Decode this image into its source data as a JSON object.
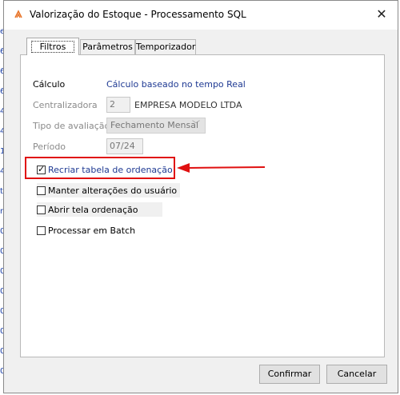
{
  "background": {
    "side_markers": [
      "e",
      "6",
      "6",
      "6",
      "4",
      "4",
      "1",
      "4",
      "t",
      "n",
      "0",
      "0",
      "0",
      "0",
      "0",
      "0",
      "0",
      "0"
    ]
  },
  "window": {
    "title": "Valorização do Estoque - Processamento SQL",
    "close_glyph": "✕"
  },
  "tabs": [
    {
      "label": "Filtros",
      "active": true
    },
    {
      "label": "Parâmetros",
      "active": false
    },
    {
      "label": "Temporizador",
      "active": false
    }
  ],
  "form": {
    "calculo_label": "Cálculo",
    "calculo_value": "Cálculo baseado no tempo Real",
    "centralizadora_label": "Centralizadora",
    "centralizadora_code": "2",
    "centralizadora_name": "EMPRESA MODELO LTDA",
    "tipo_label": "Tipo de avaliação",
    "tipo_value": "Fechamento Mensal",
    "periodo_label": "Período",
    "periodo_value": "07/24"
  },
  "options": [
    {
      "label": "Recriar tabela de ordenação",
      "checked": true
    },
    {
      "label": "Manter alterações do usuário",
      "checked": false
    },
    {
      "label": "Abrir tela ordenação",
      "checked": false
    },
    {
      "label": "Processar em Batch",
      "checked": false
    }
  ],
  "buttons": {
    "confirm_label": "Confirmar",
    "cancel_label": "Cancelar"
  },
  "colors": {
    "highlight": "#e01010",
    "link_blue": "#1f3a93",
    "app_icon": "#e8762c"
  },
  "icons": {
    "app": "orange-grid-icon",
    "close": "close-icon",
    "checkbox_checked": "check-icon"
  }
}
